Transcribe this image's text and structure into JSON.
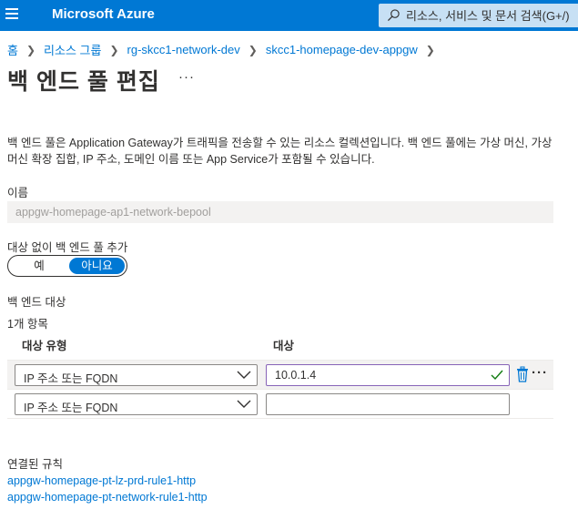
{
  "header": {
    "brand": "Microsoft Azure",
    "search_placeholder": "리소스, 서비스 및 문서 검색(G+/)"
  },
  "breadcrumb": [
    "홈",
    "리소스 그룹",
    "rg-skcc1-network-dev",
    "skcc1-homepage-dev-appgw"
  ],
  "page": {
    "title": "백 엔드 풀 편집",
    "more": "···"
  },
  "description": "백 엔드 풀은 Application Gateway가 트래픽을 전송할 수 있는 리소스 컬렉션입니다. 백 엔드 풀에는 가상 머신, 가상 머신 확장 집합, IP 주소, 도메인 이름 또는 App Service가 포함될 수 있습니다.",
  "name_field": {
    "label": "이름",
    "value": "appgw-homepage-ap1-network-bepool"
  },
  "no_target_toggle": {
    "label": "대상 없이 백 엔드 풀 추가",
    "yes": "예",
    "no": "아니요",
    "selected": "아니요"
  },
  "targets": {
    "section_label": "백 엔드 대상",
    "count": "1개 항목",
    "columns": [
      "대상 유형",
      "대상"
    ],
    "rows": [
      {
        "type": "IP 주소 또는 FQDN",
        "target": "10.0.1.4"
      },
      {
        "type": "IP 주소 또는 FQDN",
        "target": ""
      }
    ],
    "row_more": "···"
  },
  "rules": {
    "label": "연결된 규칙",
    "links": [
      "appgw-homepage-pt-lz-prd-rule1-http",
      "appgw-homepage-pt-network-rule1-http"
    ]
  },
  "colors": {
    "azure_blue": "#0078d4",
    "search_bg": "#c7e0f4",
    "focus_border": "#8764b8",
    "valid_check": "#107c10"
  }
}
